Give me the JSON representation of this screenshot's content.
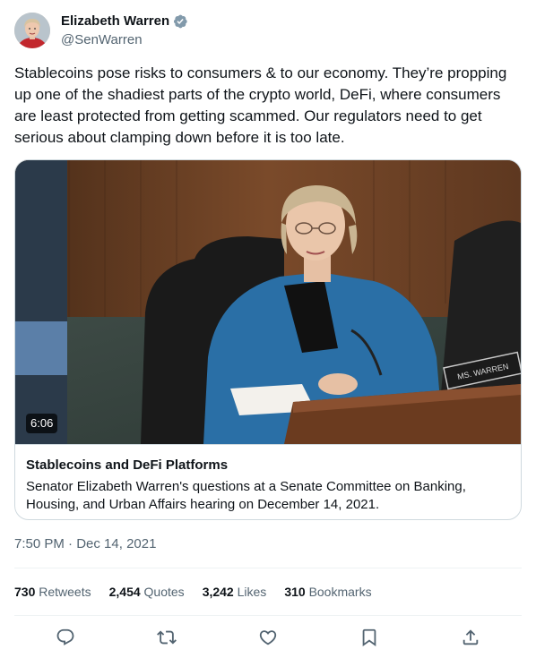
{
  "author": {
    "display_name": "Elizabeth Warren",
    "handle": "@SenWarren",
    "verified": true,
    "verified_color": "#829aab"
  },
  "tweet": {
    "text": "Stablecoins pose risks to consumers & to our economy. They’re propping up one of the shadiest parts of the crypto world, DeFi, where consumers are least protected from getting scammed. Our regulators need to get serious about clamping down before it is too late."
  },
  "card": {
    "video_duration": "6:06",
    "nameplate": "MS. WARREN",
    "title": "Stablecoins and DeFi Platforms",
    "description": "Senator Elizabeth Warren's questions at a Senate Committee on Banking, Housing, and Urban Affairs hearing on December 14, 2021."
  },
  "meta": {
    "time": "7:50 PM",
    "separator": " · ",
    "date": "Dec 14, 2021"
  },
  "stats": [
    {
      "value": "730",
      "label": "Retweets"
    },
    {
      "value": "2,454",
      "label": "Quotes"
    },
    {
      "value": "3,242",
      "label": "Likes"
    },
    {
      "value": "310",
      "label": "Bookmarks"
    }
  ],
  "actions": [
    "reply-icon",
    "retweet-icon",
    "like-icon",
    "bookmark-icon",
    "share-icon"
  ],
  "colors": {
    "text_primary": "#0f1419",
    "text_secondary": "#536471",
    "border": "#cfd9de",
    "divider": "#eff3f4"
  }
}
